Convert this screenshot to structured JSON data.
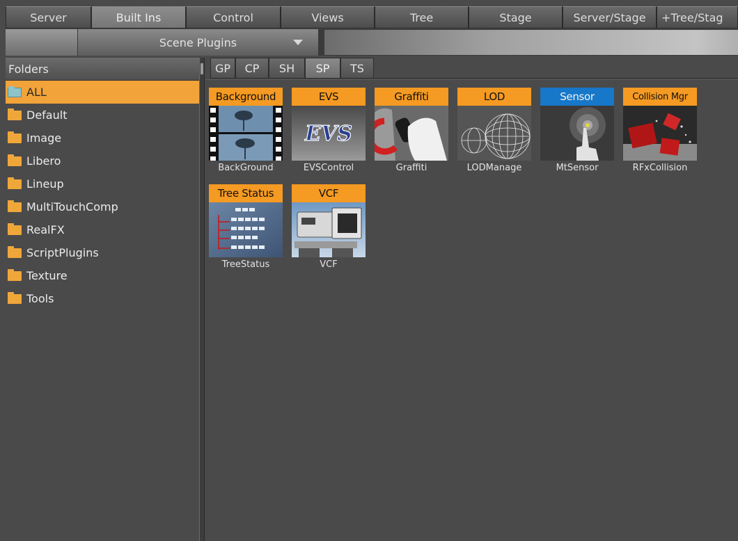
{
  "top_tabs": [
    {
      "label": "Server",
      "active": false
    },
    {
      "label": "Built Ins",
      "active": true
    },
    {
      "label": "Control",
      "active": false
    },
    {
      "label": "Views",
      "active": false
    },
    {
      "label": "Tree",
      "active": false
    },
    {
      "label": "Stage",
      "active": false
    },
    {
      "label": "Server/Stage",
      "active": false
    },
    {
      "label": "+Tree/Stag",
      "active": false
    }
  ],
  "scene_dropdown": {
    "value": "Scene Plugins"
  },
  "folders": {
    "header": "Folders",
    "items": [
      {
        "label": "ALL",
        "selected": true
      },
      {
        "label": "Default",
        "selected": false
      },
      {
        "label": "Image",
        "selected": false
      },
      {
        "label": "Libero",
        "selected": false
      },
      {
        "label": "Lineup",
        "selected": false
      },
      {
        "label": "MultiTouchComp",
        "selected": false
      },
      {
        "label": "RealFX",
        "selected": false
      },
      {
        "label": "ScriptPlugins",
        "selected": false
      },
      {
        "label": "Texture",
        "selected": false
      },
      {
        "label": "Tools",
        "selected": false
      }
    ]
  },
  "sub_tabs": [
    {
      "label": "GP",
      "active": false
    },
    {
      "label": "CP",
      "active": false
    },
    {
      "label": "SH",
      "active": false
    },
    {
      "label": "SP",
      "active": true
    },
    {
      "label": "TS",
      "active": false
    }
  ],
  "plugins": [
    {
      "label": "Background",
      "caption": "BackGround",
      "icon": "filmstrip-tree-icon",
      "color": "#f59a22"
    },
    {
      "label": "EVS",
      "caption": "EVSControl",
      "icon": "evs-logo-icon",
      "color": "#f59a22"
    },
    {
      "label": "Graffiti",
      "caption": "Graffiti",
      "icon": "spray-can-hand-icon",
      "color": "#f59a22"
    },
    {
      "label": "LOD",
      "caption": "LODManage",
      "icon": "wireframe-sphere-icon",
      "color": "#f59a22"
    },
    {
      "label": "Sensor",
      "caption": "MtSensor",
      "icon": "touch-finger-icon",
      "color": "#1777c8"
    },
    {
      "label": "Collision Mgr",
      "caption": "RFxCollision",
      "icon": "red-cubes-icon",
      "color": "#f59a22"
    },
    {
      "label": "Tree Status",
      "caption": "TreeStatus",
      "icon": "tree-hierarchy-icon",
      "color": "#f59a22"
    },
    {
      "label": "VCF",
      "caption": "VCF",
      "icon": "camera-icon",
      "color": "#f59a22"
    }
  ]
}
